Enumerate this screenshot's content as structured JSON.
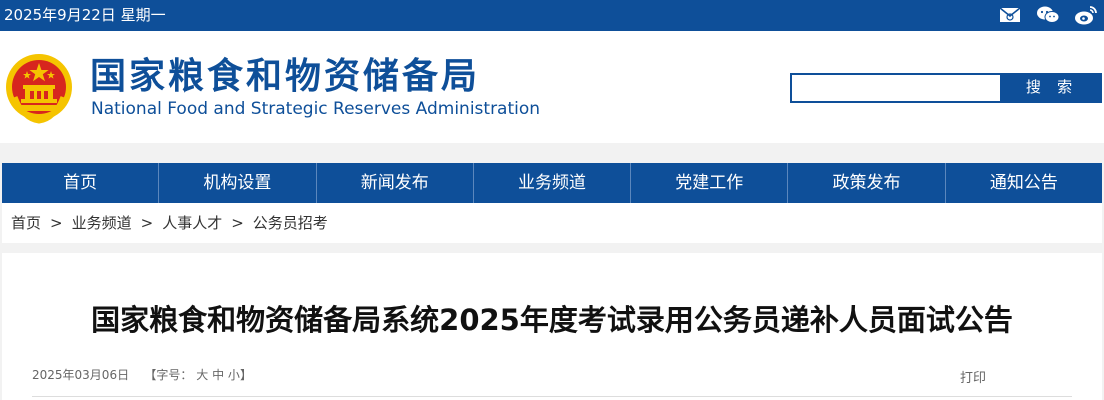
{
  "topbar": {
    "date": "2025年9月22日 星期一",
    "icons": [
      "email-icon",
      "wechat-icon",
      "weibo-icon"
    ]
  },
  "header": {
    "title_cn": "国家粮食和物资储备局",
    "title_en": "National Food and Strategic Reserves Administration",
    "search_value": "",
    "search_button": "搜 索"
  },
  "nav": {
    "items": [
      "首页",
      "机构设置",
      "新闻发布",
      "业务频道",
      "党建工作",
      "政策发布",
      "通知公告"
    ]
  },
  "breadcrumb": {
    "items": [
      "首页",
      "业务频道",
      "人事人才",
      "公务员招考"
    ],
    "separator": ">"
  },
  "article": {
    "title": "国家粮食和物资储备局系统2025年度考试录用公务员递补人员面试公告",
    "date": "2025年03月06日",
    "font_size_label": "【字号：",
    "size_large": "大",
    "size_medium": "中",
    "size_small": "小",
    "font_size_end": "】",
    "print": "打印"
  },
  "colors": {
    "brand_blue": "#0e4f99",
    "emblem_red": "#d7261e",
    "emblem_gold": "#f5c400"
  }
}
